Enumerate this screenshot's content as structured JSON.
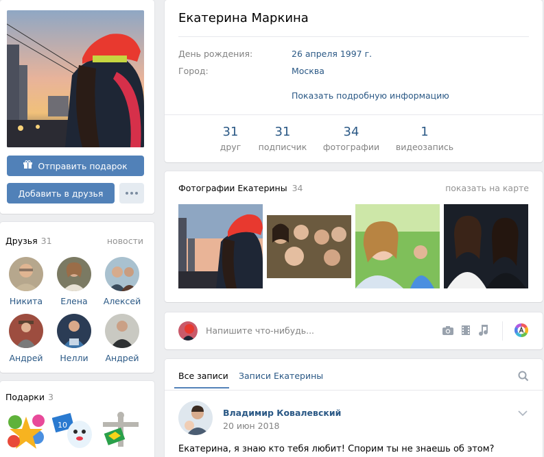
{
  "profile": {
    "name": "Екатерина Маркина",
    "birthday_label": "День рождения:",
    "birthday_value": "26 апреля 1997 г.",
    "city_label": "Город:",
    "city_value": "Москва",
    "more_info": "Показать подробную информацию"
  },
  "actions": {
    "send_gift": "Отправить подарок",
    "add_friend": "Добавить в друзья"
  },
  "stats": [
    {
      "value": "31",
      "label": "друг"
    },
    {
      "value": "31",
      "label": "подписчик"
    },
    {
      "value": "34",
      "label": "фотографии"
    },
    {
      "value": "1",
      "label": "видеозапись"
    }
  ],
  "photos_block": {
    "title": "Фотографии Екатерины",
    "count": "34",
    "map_link": "показать на карте"
  },
  "friends": {
    "title": "Друзья",
    "count": "31",
    "news_link": "новости",
    "items": [
      {
        "name": "Никита"
      },
      {
        "name": "Елена"
      },
      {
        "name": "Алексей"
      },
      {
        "name": "Андрей"
      },
      {
        "name": "Нелли"
      },
      {
        "name": "Андрей"
      }
    ]
  },
  "gifts": {
    "title": "Подарки",
    "count": "3"
  },
  "compose": {
    "placeholder": "Напишите что-нибудь..."
  },
  "wall": {
    "tab_all": "Все записи",
    "tab_owner": "Записи Екатерины",
    "post": {
      "author": "Владимир Ковалевский",
      "date": "20 июн 2018",
      "text": "Екатерина, я знаю кто тебя любит! Спорим ты не знаешь об этом?"
    }
  },
  "icons": {
    "gift": "gift-icon",
    "more": "more-dots-icon",
    "camera": "camera-icon",
    "video": "film-icon",
    "music": "music-note-icon",
    "poster": "poster-icon",
    "search": "search-icon",
    "chevron": "chevron-down-icon"
  },
  "colors": {
    "accent": "#5181b8",
    "link": "#2a5885",
    "muted": "#828282",
    "background": "#edeef0"
  }
}
